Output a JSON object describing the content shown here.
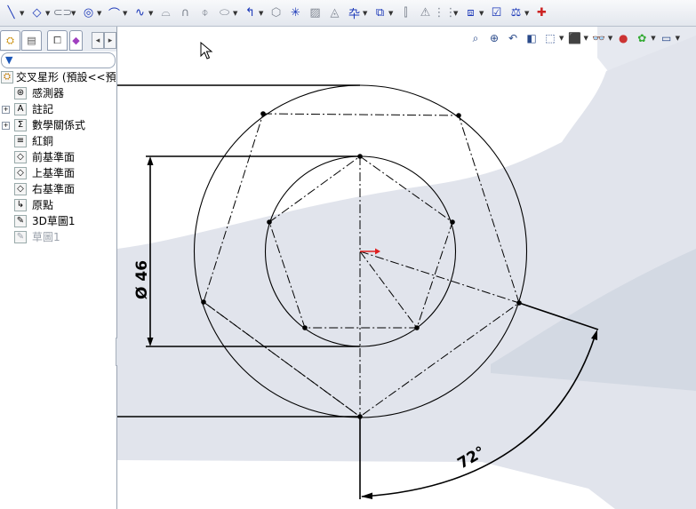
{
  "toolbar": {
    "icons": [
      "line-icon",
      "polygon-tool-icon",
      "slot-icon",
      "circle-icon",
      "arc-icon",
      "spline-icon",
      "fillet-icon",
      "offset-icon",
      "mirror-icon",
      "trim-icon",
      "convert-entities-icon",
      "point-icon",
      "centerline-icon",
      "construction-geometry-icon",
      "plane-icon",
      "dimension-icon",
      "relations-icon",
      "pattern-icon",
      "layer-icon",
      "quick-snaps-icon",
      "rapid-sketch-icon",
      "sketch-check-icon",
      "move-icon"
    ]
  },
  "tabs": [
    "feature-manager-tab",
    "property-manager-tab",
    "configuration-manager-tab",
    "dimxpert-tab"
  ],
  "tree": {
    "root": "交叉星形 (預設<<預",
    "items": [
      {
        "label": "感測器",
        "icon": "sensor-icon"
      },
      {
        "label": "註記",
        "icon": "annotation-icon",
        "expandable": true
      },
      {
        "label": "數學關係式",
        "icon": "equation-icon",
        "expandable": true
      },
      {
        "label": "紅銅",
        "icon": "material-icon"
      },
      {
        "label": "前基準面",
        "icon": "plane-icon"
      },
      {
        "label": "上基準面",
        "icon": "plane-icon"
      },
      {
        "label": "右基準面",
        "icon": "plane-icon"
      },
      {
        "label": "原點",
        "icon": "origin-icon"
      },
      {
        "label": "3D草圖1",
        "icon": "3d-sketch-icon"
      },
      {
        "label": "草圖1",
        "icon": "sketch-icon",
        "dimmed": true
      }
    ]
  },
  "dimensions": {
    "diameter": "Ø 46",
    "angle": "72°"
  },
  "colors": {
    "bg_grey": "#dfe2ea",
    "bg_grey_dark": "#cfd5df",
    "sketch_black": "#000000",
    "origin_red": "#e02020"
  }
}
